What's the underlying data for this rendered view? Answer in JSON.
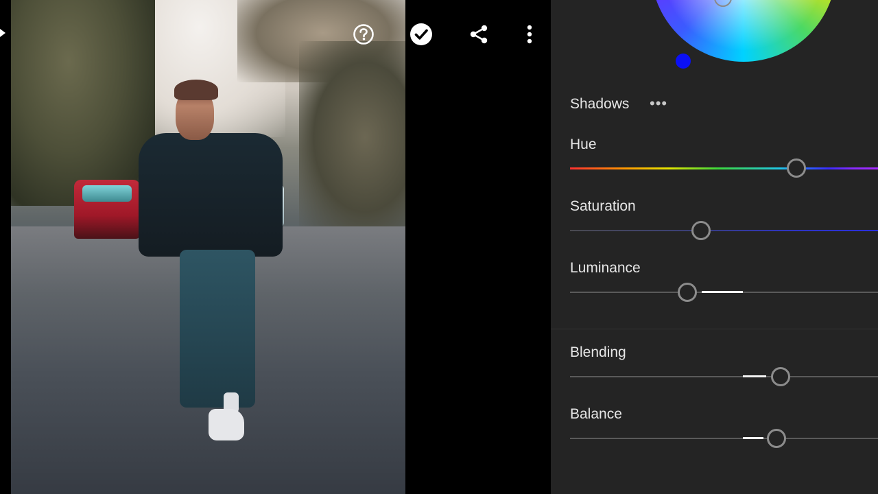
{
  "toolbar": {
    "help_icon": "help-circle-icon",
    "done_icon": "checkmark-circle-icon",
    "share_icon": "share-icon",
    "more_icon": "more-vertical-icon"
  },
  "panel": {
    "section_title": "Shadows",
    "section_more": "•••",
    "sliders": {
      "hue": {
        "label": "Hue",
        "value": 0.74
      },
      "saturation": {
        "label": "Saturation",
        "value": 0.43
      },
      "luminance": {
        "label": "Luminance",
        "value": 0.38
      },
      "blending": {
        "label": "Blending",
        "value": 0.69
      },
      "balance": {
        "label": "Balance",
        "value": 0.67
      }
    },
    "colors": {
      "background": "#242424",
      "shadow_tint": "#0b10f5",
      "thumb_border": "#8c8c8c",
      "label_text": "#e6e6e6"
    }
  }
}
